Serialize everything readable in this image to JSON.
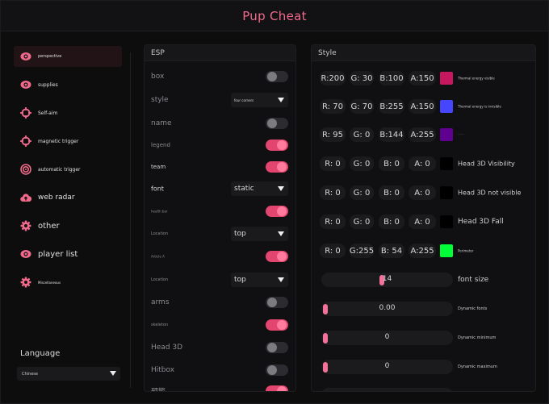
{
  "app": {
    "title": "Pup Cheat",
    "accent": "#f06a8c"
  },
  "sidebar": {
    "items": [
      {
        "label": "perspective",
        "icon": "eye-icon"
      },
      {
        "label": "supplies",
        "icon": "eye-icon"
      },
      {
        "label": "Self-aim",
        "icon": "crosshair-icon"
      },
      {
        "label": "magnetic trigger",
        "icon": "crosshair-icon"
      },
      {
        "label": "automatic trigger",
        "icon": "target-icon"
      },
      {
        "label": "web radar",
        "icon": "cloud-upload-icon"
      },
      {
        "label": "other",
        "icon": "gear-icon"
      },
      {
        "label": "player list",
        "icon": "eye-icon"
      },
      {
        "label": "Miscellaneous",
        "icon": "gear-icon"
      }
    ],
    "language": {
      "title": "Language",
      "value": "Chinese"
    }
  },
  "esp": {
    "title": "ESP",
    "rows": [
      {
        "label": "box",
        "control": "toggle",
        "on": false
      },
      {
        "label": "style",
        "control": "dropdown",
        "value": "four corners"
      },
      {
        "label": "name",
        "control": "toggle",
        "on": false
      },
      {
        "label": "legend",
        "control": "toggle",
        "on": true
      },
      {
        "label": "team",
        "control": "toggle",
        "on": true
      },
      {
        "label": "font",
        "control": "dropdown",
        "value": "static"
      },
      {
        "label": "health bar",
        "control": "toggle",
        "on": true
      },
      {
        "label": "Location",
        "control": "dropdown",
        "value": "top"
      },
      {
        "label": "Article A",
        "control": "toggle",
        "on": true
      },
      {
        "label": "Location",
        "control": "dropdown",
        "value": "top"
      },
      {
        "label": "arms",
        "control": "toggle",
        "on": false
      },
      {
        "label": "skeleton",
        "control": "toggle",
        "on": true
      },
      {
        "label": "Head 3D",
        "control": "toggle",
        "on": false
      },
      {
        "label": "Hitbox",
        "control": "toggle",
        "on": false
      },
      {
        "label": "预警",
        "control": "toggle",
        "on": true
      }
    ]
  },
  "style": {
    "title": "Style",
    "colors": [
      {
        "r": "R:200",
        "g": "G: 30",
        "b": "B:100",
        "a": "A:150",
        "hex": "#c7175f",
        "label": "Thermal energy visible"
      },
      {
        "r": "R: 70",
        "g": "G: 70",
        "b": "B:255",
        "a": "A:150",
        "hex": "#4646ff",
        "label": "Thermal energy is invisible"
      },
      {
        "r": "R: 95",
        "g": "G:  0",
        "b": "B:144",
        "a": "A:255",
        "hex": "#5f0090",
        "label": "············"
      },
      {
        "r": "R:  0",
        "g": "G:  0",
        "b": "B:  0",
        "a": "A:  0",
        "hex": "#000000",
        "label": "Head 3D Visibility"
      },
      {
        "r": "R:  0",
        "g": "G:  0",
        "b": "B:  0",
        "a": "A:  0",
        "hex": "#000000",
        "label": "Head 3D not visible"
      },
      {
        "r": "R:  0",
        "g": "G:  0",
        "b": "B:  0",
        "a": "A:  0",
        "hex": "#000000",
        "label": "Head 3D Fall"
      },
      {
        "r": "R:  0",
        "g": "G:255",
        "b": "B: 54",
        "a": "A:255",
        "hex": "#00ff36",
        "label": "Perimeter"
      }
    ],
    "sliders": [
      {
        "value": "14",
        "label": "font size",
        "fraction": 0.45
      },
      {
        "value": "0.00",
        "label": "Dynamic fonts",
        "fraction": 0
      },
      {
        "value": "0",
        "label": "Dynamic minimum",
        "fraction": 0
      },
      {
        "value": "0",
        "label": "Dynamic maximum",
        "fraction": 0
      }
    ]
  }
}
